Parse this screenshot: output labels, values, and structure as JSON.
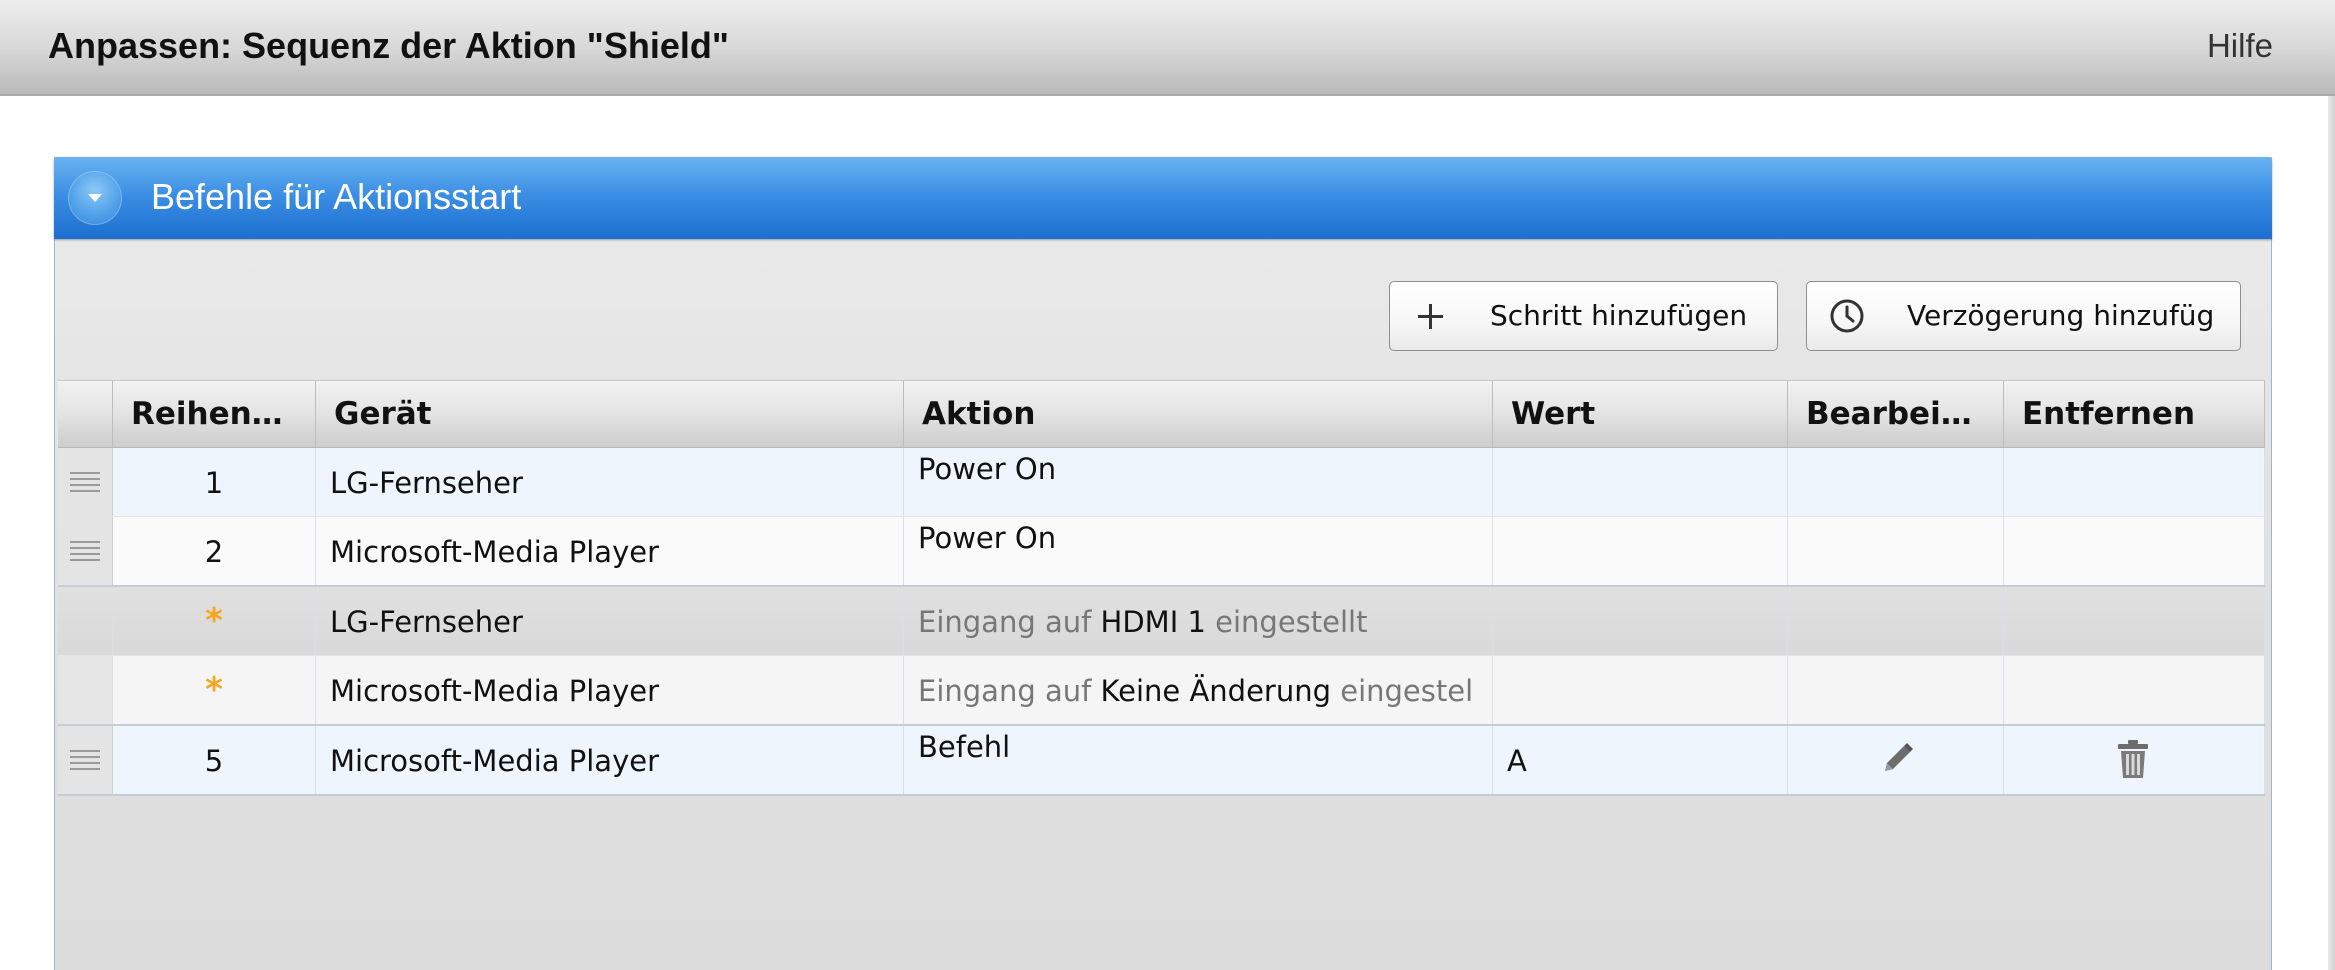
{
  "window": {
    "title": "Anpassen: Sequenz der Aktion \"Shield\"",
    "help_label": "Hilfe"
  },
  "panel": {
    "title": "Befehle für Aktionsstart",
    "collapse_icon": "chevron-down-icon",
    "header_color": "#2f82de"
  },
  "toolbar": {
    "add_step_label": "Schritt hinzufügen",
    "add_step_icon": "plus-icon",
    "add_delay_label": "Verzögerung hinzufüg",
    "add_delay_icon": "clock-icon"
  },
  "table": {
    "headers": {
      "order": "Reihen…",
      "device": "Gerät",
      "action": "Aktion",
      "value": "Wert",
      "edit": "Bearbei…",
      "remove": "Entfernen"
    },
    "rows": [
      {
        "order": "1",
        "device": "LG-Fernseher",
        "action": "Power On",
        "value": ""
      },
      {
        "order": "2",
        "device": "Microsoft-Media Player",
        "action": "Power On",
        "value": ""
      },
      {
        "order_marker": "*",
        "device": "LG-Fernseher",
        "action_prefix": "Eingang auf",
        "action_value": "HDMI 1",
        "action_suffix": "eingestellt"
      },
      {
        "order_marker": "*",
        "device": "Microsoft-Media Player",
        "action_prefix": "Eingang auf",
        "action_value": "Keine Änderung",
        "action_suffix": "eingestel"
      },
      {
        "order": "5",
        "device": "Microsoft-Media Player",
        "action": "Befehl",
        "value": "A",
        "edit_icon": "pencil-icon",
        "remove_icon": "trash-icon"
      }
    ],
    "marker_color": "#f5a623"
  }
}
